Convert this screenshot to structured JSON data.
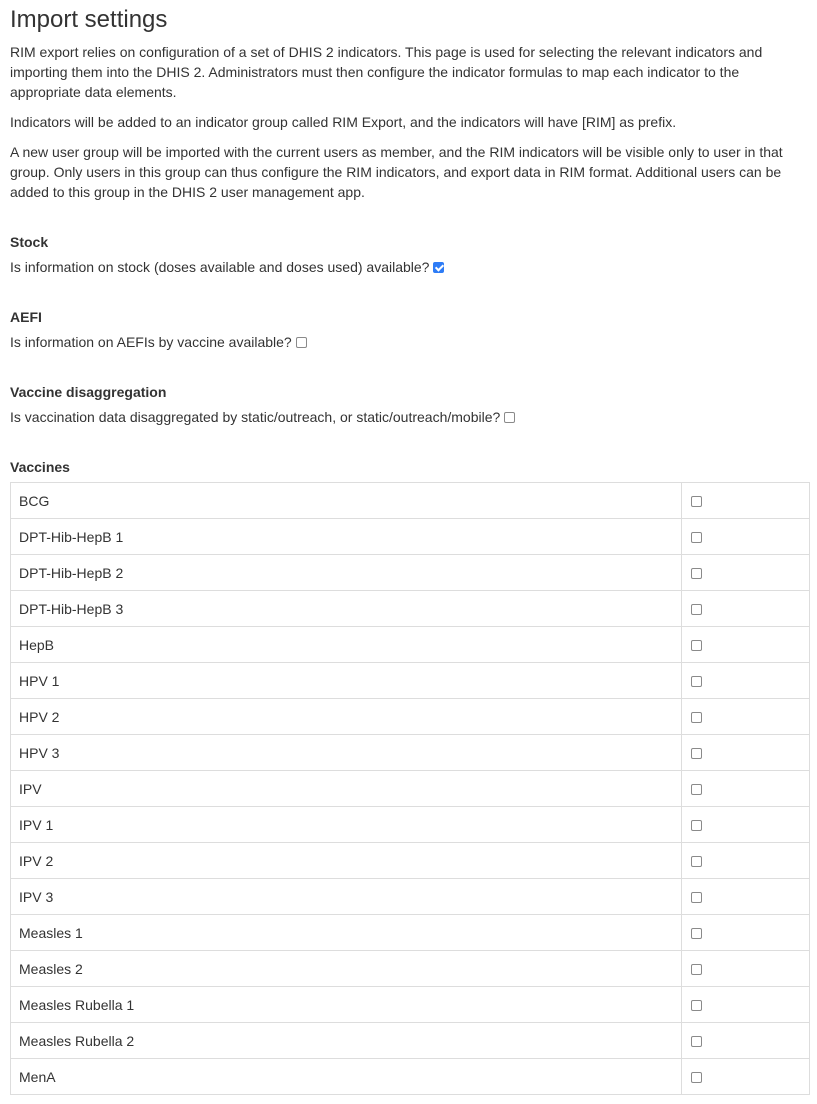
{
  "page_title": "Import settings",
  "intro": {
    "p1": "RIM export relies on configuration of a set of DHIS 2 indicators. This page is used for selecting the relevant indicators and importing them into the DHIS 2. Administrators must then configure the indicator formulas to map each indicator to the appropriate data elements.",
    "p2": "Indicators will be added to an indicator group called RIM Export, and the indicators will have [RIM] as prefix.",
    "p3": "A new user group will be imported with the current users as member, and the RIM indicators will be visible only to user in that group. Only users in this group can thus configure the RIM indicators, and export data in RIM format. Additional users can be added to this group in the DHIS 2 user management app."
  },
  "stock": {
    "heading": "Stock",
    "question": "Is information on stock (doses available and doses used) available?",
    "checked": true
  },
  "aefi": {
    "heading": "AEFI",
    "question": "Is information on AEFIs by vaccine available?",
    "checked": false
  },
  "disaggregation": {
    "heading": "Vaccine disaggregation",
    "question": "Is vaccination data disaggregated by static/outreach, or static/outreach/mobile?",
    "checked": false
  },
  "vaccines": {
    "heading": "Vaccines",
    "rows": [
      {
        "name": "BCG",
        "checked": false
      },
      {
        "name": "DPT-Hib-HepB 1",
        "checked": false
      },
      {
        "name": "DPT-Hib-HepB 2",
        "checked": false
      },
      {
        "name": "DPT-Hib-HepB 3",
        "checked": false
      },
      {
        "name": "HepB",
        "checked": false
      },
      {
        "name": "HPV 1",
        "checked": false
      },
      {
        "name": "HPV 2",
        "checked": false
      },
      {
        "name": "HPV 3",
        "checked": false
      },
      {
        "name": "IPV",
        "checked": false
      },
      {
        "name": "IPV 1",
        "checked": false
      },
      {
        "name": "IPV 2",
        "checked": false
      },
      {
        "name": "IPV 3",
        "checked": false
      },
      {
        "name": "Measles 1",
        "checked": false
      },
      {
        "name": "Measles 2",
        "checked": false
      },
      {
        "name": "Measles Rubella 1",
        "checked": false
      },
      {
        "name": "Measles Rubella 2",
        "checked": false
      },
      {
        "name": "MenA",
        "checked": false
      }
    ]
  },
  "colors": {
    "checkbox_checked": "#2e7cf6",
    "table_border": "#dddddd",
    "text": "#333333"
  }
}
